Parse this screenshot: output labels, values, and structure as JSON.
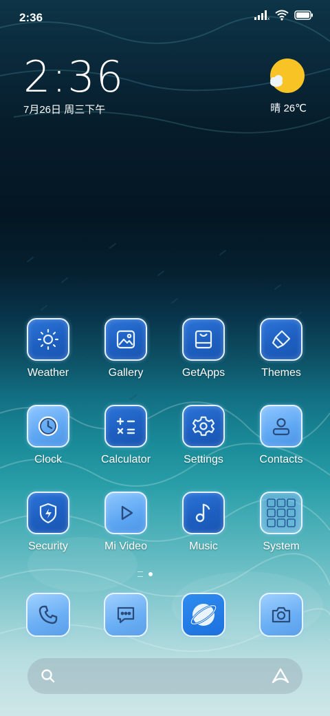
{
  "status_bar": {
    "time": "2:36",
    "icons": [
      "signal-icon",
      "wifi-icon",
      "battery-icon"
    ]
  },
  "clock_widget": {
    "time": "2:36",
    "date": "7月26日 周三下午"
  },
  "weather_widget": {
    "icon": "sun-cloud-icon",
    "text": "晴 26℃"
  },
  "apps": [
    {
      "label": "Weather",
      "icon": "sun-icon"
    },
    {
      "label": "Gallery",
      "icon": "image-icon"
    },
    {
      "label": "GetApps",
      "icon": "shopping-bag-icon"
    },
    {
      "label": "Themes",
      "icon": "paint-brush-icon"
    },
    {
      "label": "Clock",
      "icon": "clock-icon"
    },
    {
      "label": "Calculator",
      "icon": "calculator-icon"
    },
    {
      "label": "Settings",
      "icon": "gear-icon"
    },
    {
      "label": "Contacts",
      "icon": "person-icon"
    },
    {
      "label": "Security",
      "icon": "shield-icon"
    },
    {
      "label": "Mi Video",
      "icon": "play-icon"
    },
    {
      "label": "Music",
      "icon": "music-note-icon"
    },
    {
      "label": "System",
      "icon": "folder-grid-icon"
    }
  ],
  "dock": [
    {
      "name": "phone",
      "icon": "phone-icon"
    },
    {
      "name": "messages",
      "icon": "chat-icon"
    },
    {
      "name": "browser",
      "icon": "planet-icon"
    },
    {
      "name": "camera",
      "icon": "camera-icon"
    }
  ],
  "search_bar": {
    "icon": "search-icon",
    "assistant_icon": "assistant-icon"
  },
  "pager": {
    "pages": 2,
    "current": 2
  },
  "colors": {
    "tile_border": "#e6f2ff",
    "tile_fill": "#1d5fc0",
    "tile_light_fill": "#6aaef4",
    "sun": "#f7c325"
  }
}
